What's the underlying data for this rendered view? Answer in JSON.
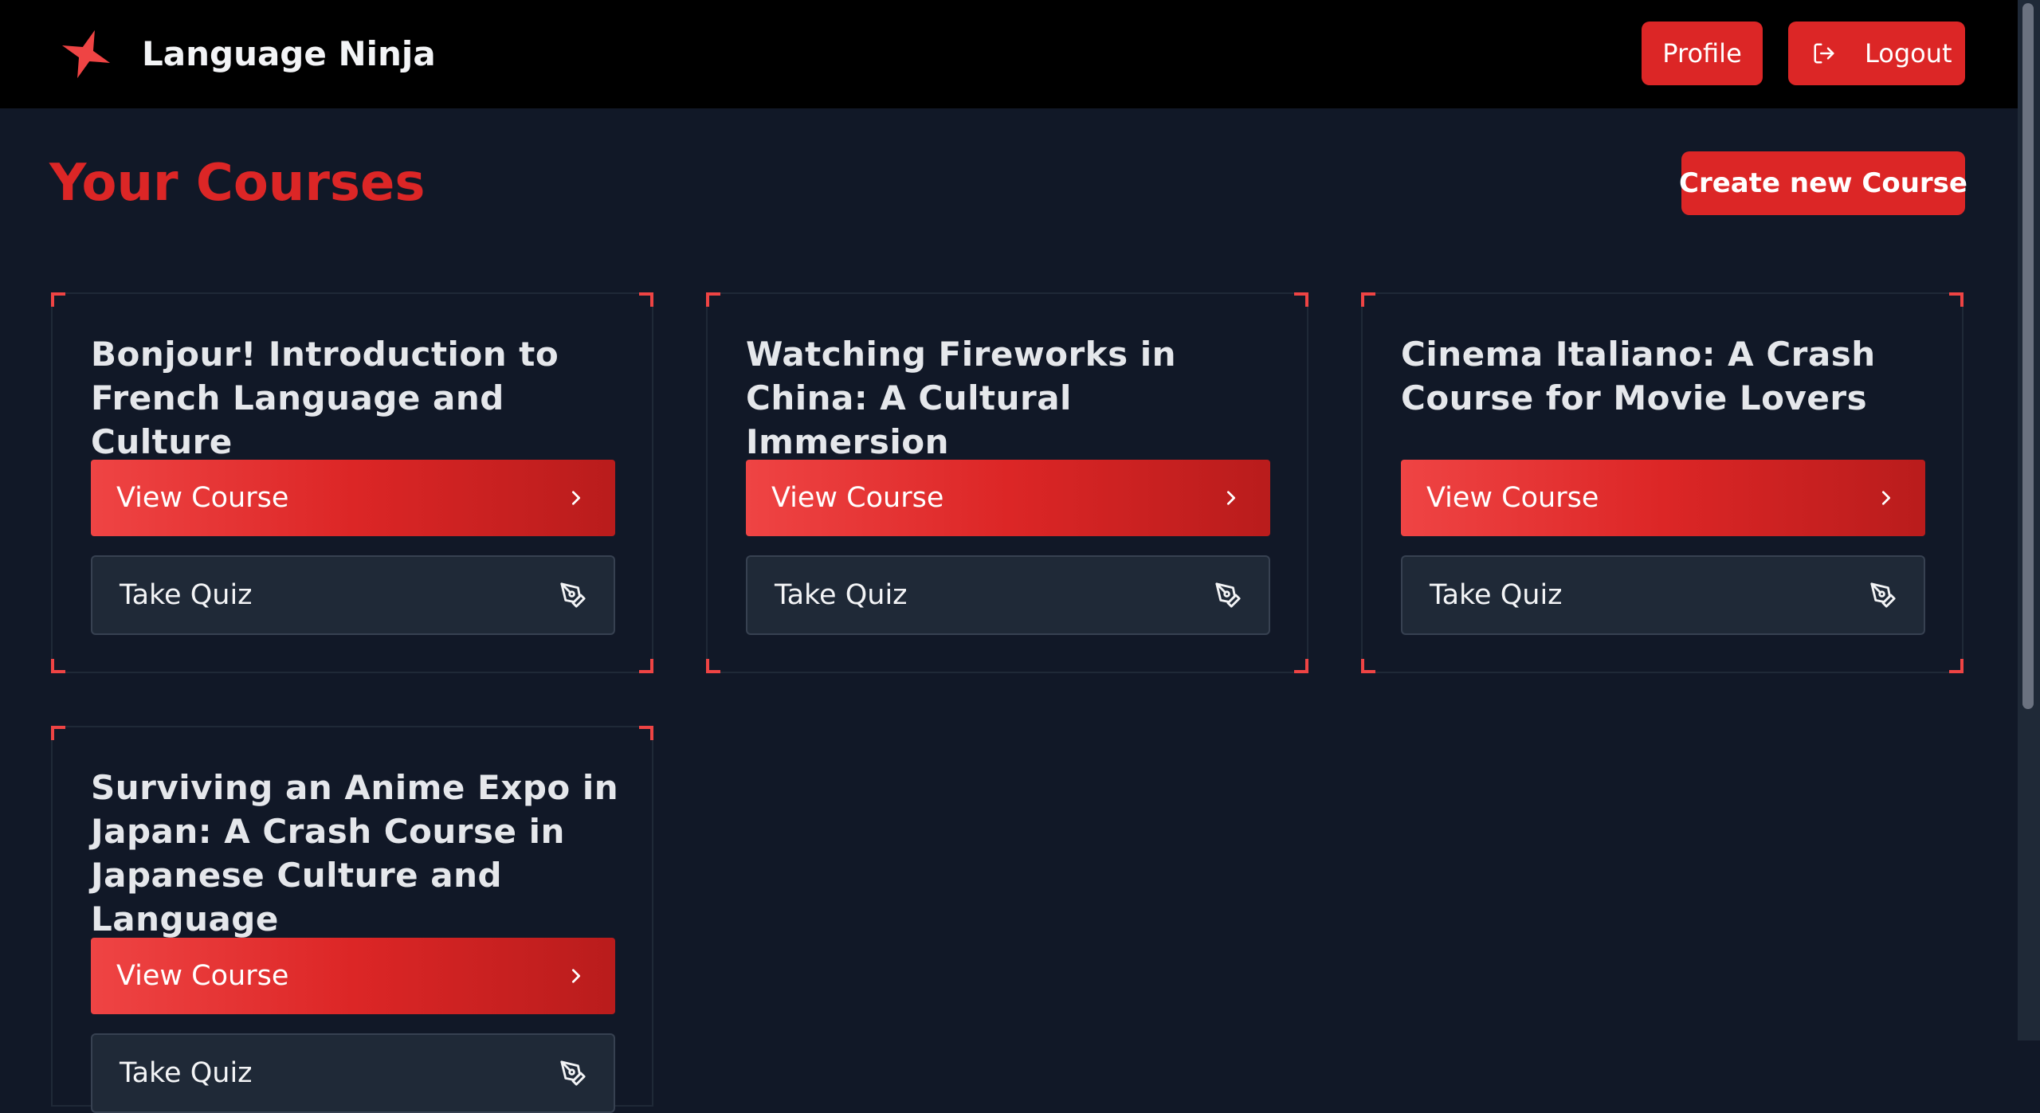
{
  "header": {
    "app_title": "Language Ninja",
    "profile_label": "Profile",
    "logout_label": "Logout"
  },
  "main": {
    "page_title": "Your Courses",
    "create_label": "Create new Course"
  },
  "courses": [
    {
      "title": "Bonjour! Introduction to French Language and Culture",
      "view_label": "View Course",
      "quiz_label": "Take Quiz"
    },
    {
      "title": "Watching Fireworks in China: A Cultural Immersion",
      "view_label": "View Course",
      "quiz_label": "Take Quiz"
    },
    {
      "title": "Cinema Italiano: A Crash Course for Movie Lovers",
      "view_label": "View Course",
      "quiz_label": "Take Quiz"
    },
    {
      "title": "Surviving an Anime Expo in Japan: A Crash Course in Japanese Culture and Language",
      "view_label": "View Course",
      "quiz_label": "Take Quiz"
    }
  ],
  "icons": {
    "logo": "sparkle-icon",
    "logout": "logout-icon",
    "view": "chevron-right-icon",
    "quiz": "pen-tool-icon"
  },
  "colors": {
    "accent": "#dc2626",
    "background": "#111827",
    "header": "#000000"
  }
}
